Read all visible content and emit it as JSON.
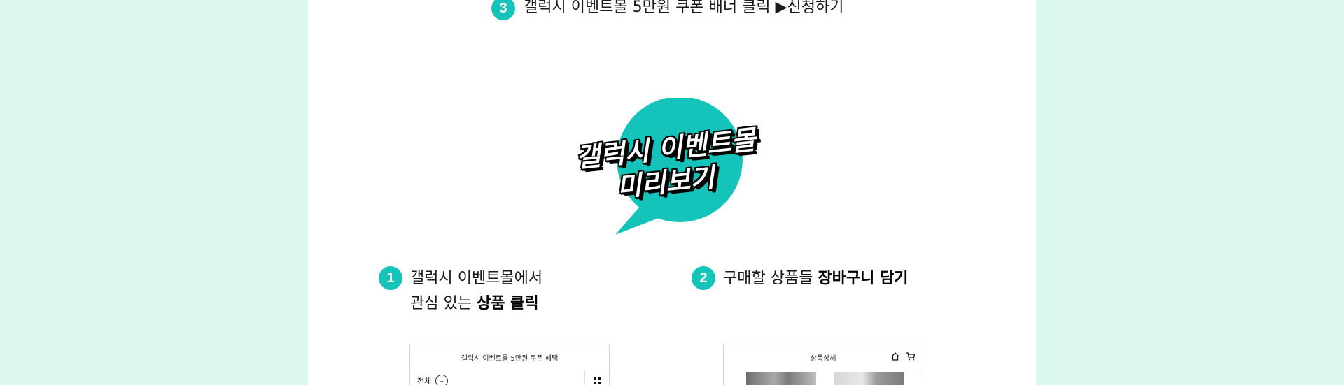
{
  "colors": {
    "page_bg": "#dcf8ef",
    "accent": "#14c4ba"
  },
  "top_step": {
    "number": "3",
    "text": "갤럭시 이벤트몰 5만원 쿠폰 배너 클릭 ▶신청하기"
  },
  "bubble": {
    "line1": "갤럭시 이벤트몰",
    "line2": "미리보기"
  },
  "step1": {
    "number": "1",
    "line1": "갤럭시 이벤트몰에서",
    "line2_prefix": "관심 있는 ",
    "line2_bold": "상품 클릭"
  },
  "step2": {
    "number": "2",
    "prefix": "구매할 상품들 ",
    "bold": "장바구니 담기"
  },
  "phone1": {
    "header": "갤럭시 이벤트몰 5만원 쿠폰 혜택",
    "filter_label": "전체",
    "icons": {
      "dropdown": "chevron-down-icon",
      "view": "grid-icon"
    }
  },
  "phone2": {
    "header": "상품상세",
    "icons": {
      "home": "home-icon",
      "cart": "cart-icon"
    }
  }
}
